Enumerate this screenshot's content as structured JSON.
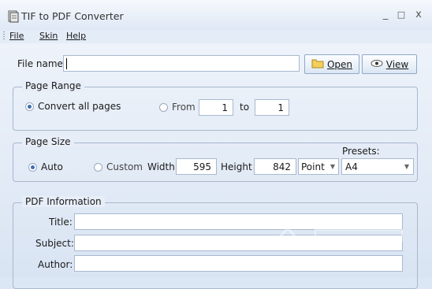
{
  "window": {
    "title": "TIF to PDF Converter",
    "min": "_",
    "max": "□",
    "close": "x"
  },
  "menu": {
    "file": "File",
    "skin": "Skin",
    "help": "Help"
  },
  "file": {
    "label": "File name:",
    "value": "",
    "open": "Open",
    "view": "View"
  },
  "page_range": {
    "legend": "Page Range",
    "all_label": "Convert all pages",
    "from_label": "From",
    "from_value": "1",
    "to_label": "to",
    "to_value": "1",
    "selected": "all"
  },
  "page_size": {
    "legend": "Page Size",
    "auto_label": "Auto",
    "custom_label": "Custom",
    "width_label": "Width",
    "width_value": "595",
    "height_label": "Height",
    "height_value": "842",
    "unit": "Point",
    "presets_label": "Presets:",
    "preset": "A4",
    "selected": "auto"
  },
  "pdf_info": {
    "legend": "PDF Information",
    "title_label": "Title:",
    "title_value": "",
    "subject_label": "Subject:",
    "subject_value": "",
    "author_label": "Author:",
    "author_value": ""
  },
  "colors": {
    "accent": "#3d6fb6",
    "border": "#a7b8cf",
    "background": "#dce7f5"
  }
}
